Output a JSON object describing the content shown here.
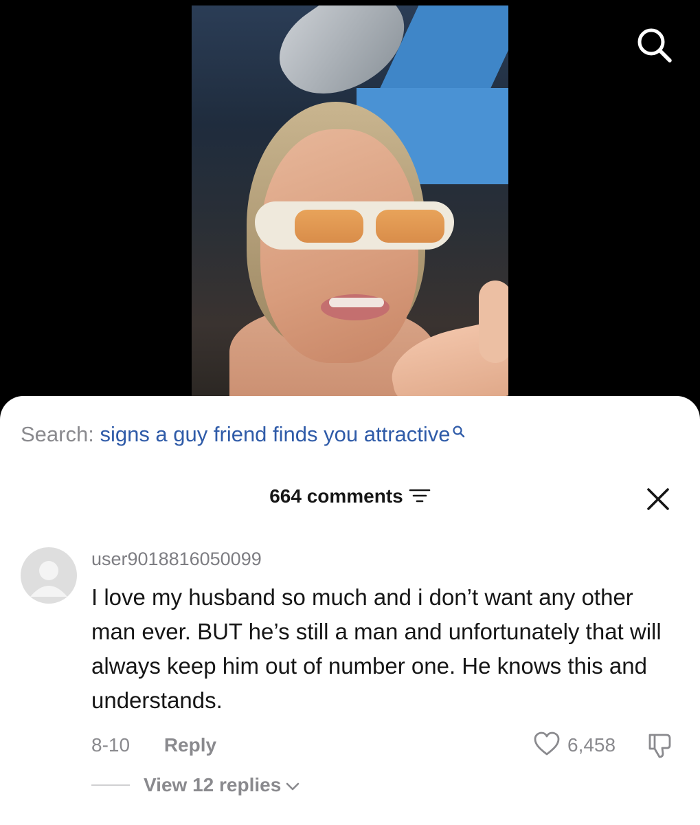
{
  "video": {
    "search_icon": "search-icon"
  },
  "search_bar": {
    "prefix": "Search: ",
    "query": "signs a guy friend finds you attractive",
    "icon": "search-icon"
  },
  "comments_header": {
    "title": "664 comments",
    "filter_icon": "filter-icon",
    "close_icon": "close-icon"
  },
  "comment": {
    "username": "user9018816050099",
    "text": "I love my husband so much and i don’t want any other man ever. BUT he’s still a man and unfortunately that will always keep him out of number one. He knows this and understands.",
    "date": "8-10",
    "reply_label": "Reply",
    "like_count": "6,458",
    "like_icon": "heart-icon",
    "dislike_icon": "thumbs-down-icon",
    "view_replies_label": "View 12 replies"
  },
  "colors": {
    "query_link": "#2f5ba8",
    "muted_text": "#8a8a8e",
    "primary_text": "#161616"
  }
}
